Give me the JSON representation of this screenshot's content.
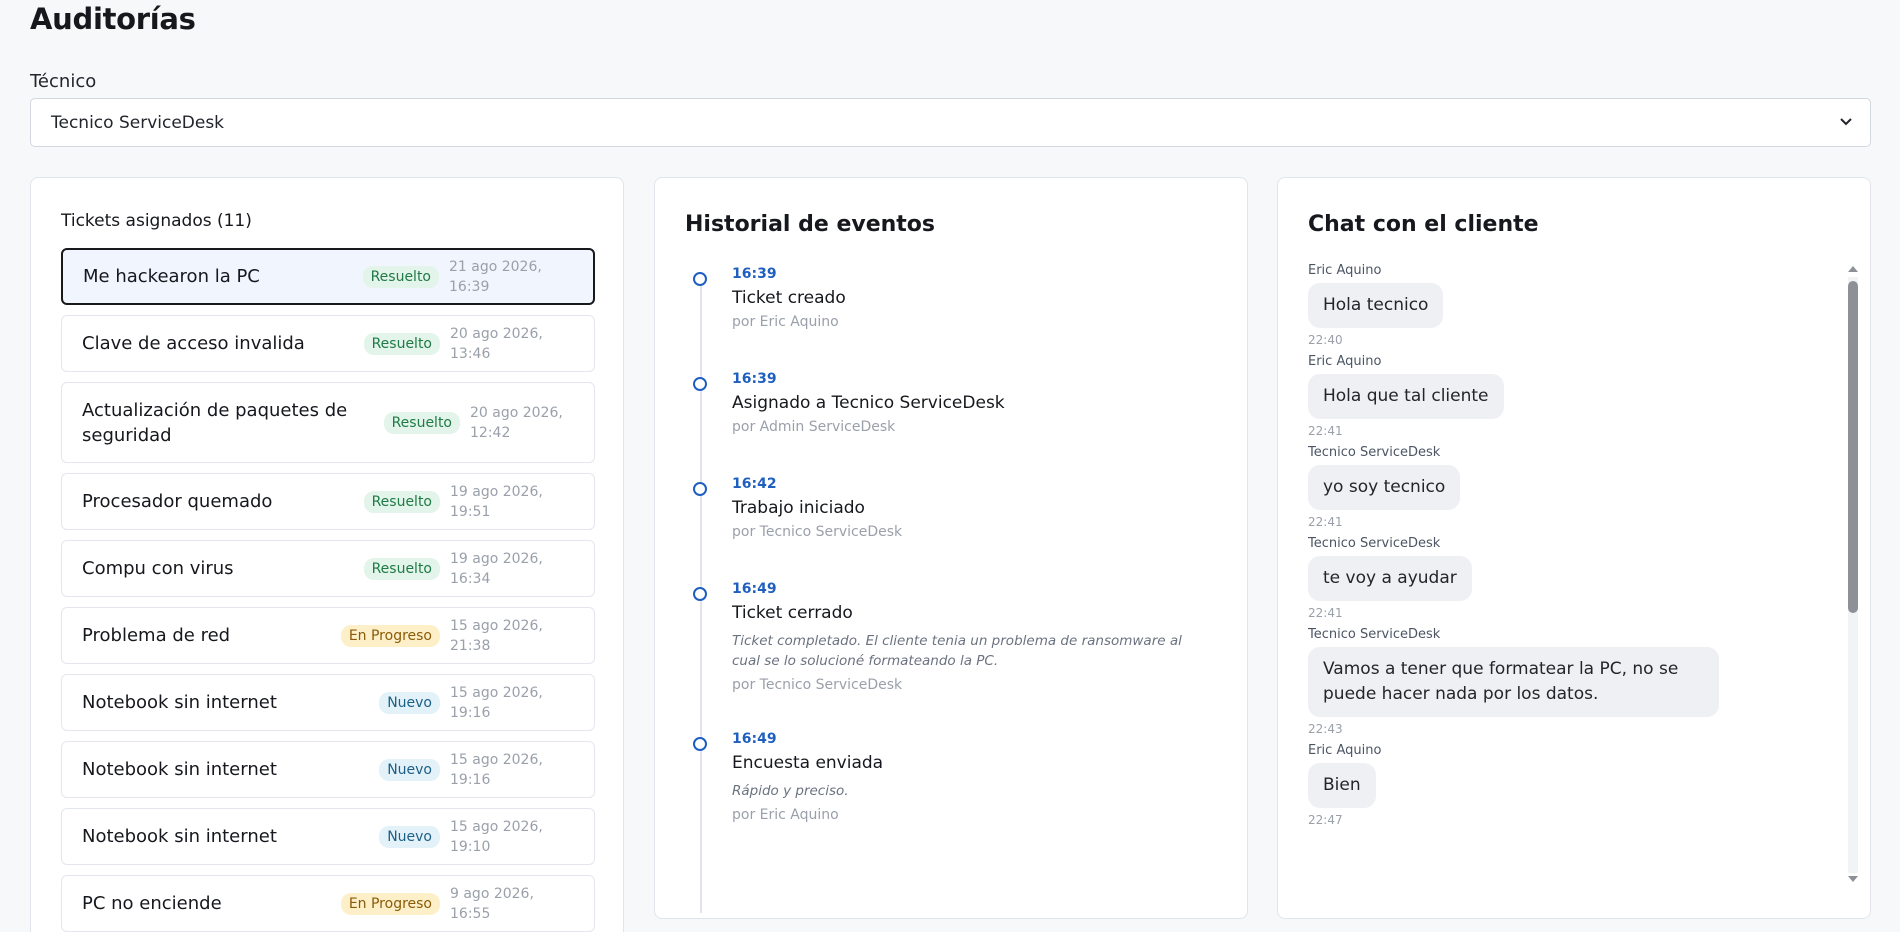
{
  "page": {
    "title": "Auditorías"
  },
  "filter": {
    "label": "Técnico",
    "selected": "Tecnico ServiceDesk"
  },
  "tickets": {
    "header": "Tickets asignados (11)",
    "items": [
      {
        "title": "Me hackearon la PC",
        "status": "Resuelto",
        "date": "21 ago 2026, 16:39"
      },
      {
        "title": "Clave de acceso invalida",
        "status": "Resuelto",
        "date": "20 ago 2026, 13:46"
      },
      {
        "title": "Actualización de paquetes de seguridad",
        "status": "Resuelto",
        "date": "20 ago 2026, 12:42"
      },
      {
        "title": "Procesador quemado",
        "status": "Resuelto",
        "date": "19 ago 2026, 19:51"
      },
      {
        "title": "Compu con virus",
        "status": "Resuelto",
        "date": "19 ago 2026, 16:34"
      },
      {
        "title": "Problema de red",
        "status": "En Progreso",
        "date": "15 ago 2026, 21:38"
      },
      {
        "title": "Notebook sin internet",
        "status": "Nuevo",
        "date": "15 ago 2026, 19:16"
      },
      {
        "title": "Notebook sin internet",
        "status": "Nuevo",
        "date": "15 ago 2026, 19:16"
      },
      {
        "title": "Notebook sin internet",
        "status": "Nuevo",
        "date": "15 ago 2026, 19:10"
      },
      {
        "title": "PC no enciende",
        "status": "En Progreso",
        "date": "9 ago 2026, 16:55"
      }
    ]
  },
  "events": {
    "title": "Historial de eventos",
    "items": [
      {
        "time": "16:39",
        "title": "Ticket creado",
        "note": "",
        "by": "por Eric Aquino"
      },
      {
        "time": "16:39",
        "title": "Asignado a Tecnico ServiceDesk",
        "note": "",
        "by": "por Admin ServiceDesk"
      },
      {
        "time": "16:42",
        "title": "Trabajo iniciado",
        "note": "",
        "by": "por Tecnico ServiceDesk"
      },
      {
        "time": "16:49",
        "title": "Ticket cerrado",
        "note": "Ticket completado. El cliente tenia un problema de ransomware al cual se lo solucioné formateando la PC.",
        "by": "por Tecnico ServiceDesk"
      },
      {
        "time": "16:49",
        "title": "Encuesta enviada",
        "note": "Rápido y preciso.",
        "by": "por Eric Aquino"
      }
    ]
  },
  "chat": {
    "title": "Chat con el cliente",
    "messages": [
      {
        "author": "Eric Aquino",
        "text": "Hola tecnico",
        "time": "22:40"
      },
      {
        "author": "Eric Aquino",
        "text": "Hola que tal cliente",
        "time": "22:41"
      },
      {
        "author": "Tecnico ServiceDesk",
        "text": "yo soy tecnico",
        "time": "22:41"
      },
      {
        "author": "Tecnico ServiceDesk",
        "text": "te voy a ayudar",
        "time": "22:41"
      },
      {
        "author": "Tecnico ServiceDesk",
        "text": "Vamos a tener que formatear la PC, no se puede hacer nada por los datos.",
        "time": "22:43"
      },
      {
        "author": "Eric Aquino",
        "text": "Bien",
        "time": "22:47"
      }
    ]
  },
  "colors": {
    "accent": "#1f5fbf",
    "resuelto_bg": "#e3f4ea",
    "resuelto_fg": "#1f7a46",
    "progreso_bg": "#fdf0c9",
    "progreso_fg": "#8a5a08",
    "nuevo_bg": "#e3f1f8",
    "nuevo_fg": "#1c5f86"
  }
}
